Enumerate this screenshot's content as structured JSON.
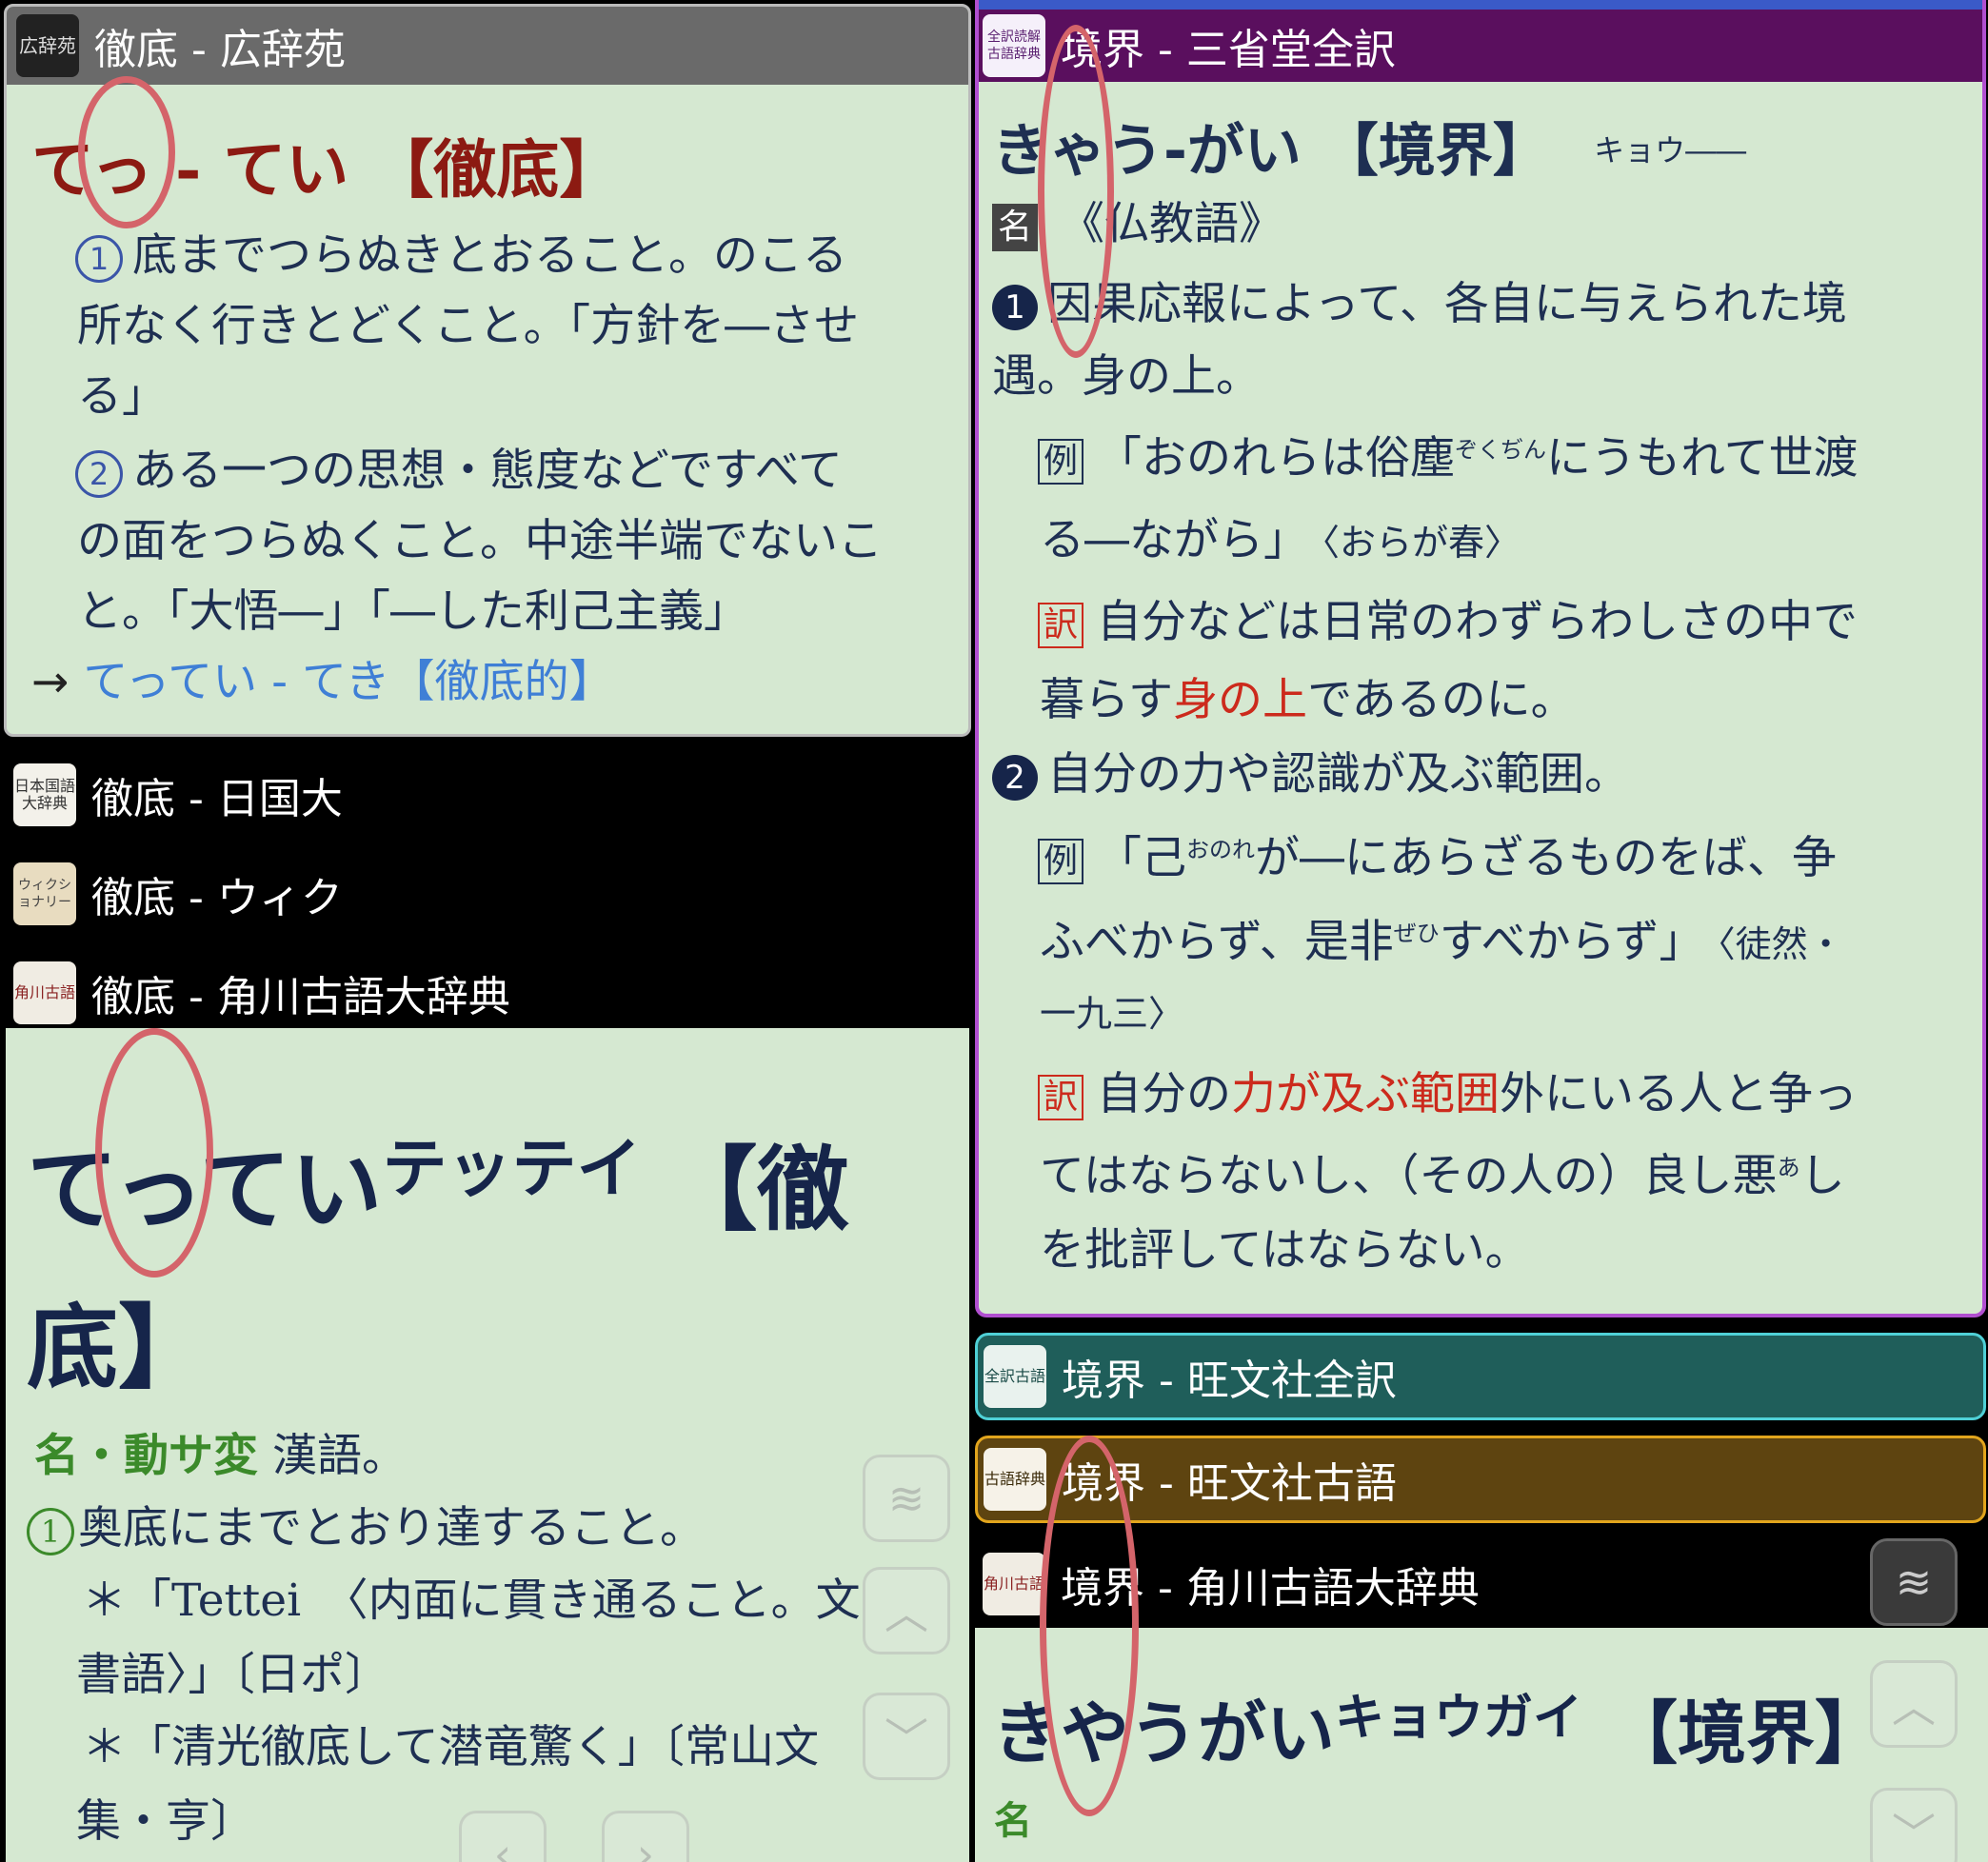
{
  "left_top": {
    "title_bar": {
      "icon": "広辞苑",
      "title": "徹底 - 広辞苑"
    },
    "headword": "てっ - てい 【徹底】",
    "lines": [
      "底までつらぬきとおること。のこる",
      "所なく行きとどくこと。「方針を―させ",
      "る」",
      "ある一つの思想・態度などですべて",
      "の面をつらぬくこと。中途半端でないこ",
      "と。「大悟―」「―した利己主義」"
    ],
    "num1": "1",
    "num2": "2",
    "link_arrow": "→",
    "link": "てってい - てき【徹底的】"
  },
  "left_list": [
    {
      "icon": "日本国語大辞典",
      "title": "徹底 - 日国大"
    },
    {
      "icon": "ウィクショナリー",
      "title": "徹底 - ウィク"
    },
    {
      "icon": "角川古語",
      "title": "徹底 - 角川古語大辞典"
    }
  ],
  "left_bottom": {
    "headword_kana": "てってい",
    "headword_katakana": "テッテイ",
    "headword_kanji_1": "【徹",
    "headword_kanji_2": "底】",
    "pos": "名・動サ変",
    "pos_rest": " 漢語。",
    "num1": "1",
    "lines": [
      "奥底にまでとおり達すること。",
      "＊「Tettei　〈内面に貫き通ること。文",
      "書語〉」〔日ポ〕",
      "＊「清光徹底して潜竜驚く」〔常山文",
      "集・亨〕"
    ]
  },
  "right_top": {
    "title_bar": {
      "icon": "全訳読解古語辞典",
      "title": "境界 - 三省堂全訳"
    },
    "headword": "きゃう-がい 【境界】",
    "reading": "キョウ――",
    "pos_tag": "名",
    "pos_text": "《仏教語》",
    "sense1_num": "1",
    "sense1": [
      "因果応報によって、各自に与えられた境",
      "遇。身の上。"
    ],
    "example_tag": "例",
    "example1": [
      "「おのれらは俗塵",
      "ぞくぢん",
      "にうもれて世渡",
      "る―ながら」",
      "〈おらが春〉"
    ],
    "translation_tag": "訳",
    "trans1_a": "自分などは日常のわずらわしさの中で",
    "trans1_b_pre": "暮らす",
    "trans1_b_red": "身の上",
    "trans1_b_post": "であるのに。",
    "sense2_num": "2",
    "sense2": "自分の力や認識が及ぶ範囲。",
    "example2": [
      "「己",
      "おのれ",
      "が―にあらざるものをば、争",
      "ふべからず、是非",
      "ぜひ",
      "すべからず」",
      "〈徒然・",
      "一九三〉"
    ],
    "trans2_a_pre": "自分の",
    "trans2_a_red": "力が及ぶ範囲",
    "trans2_a_post": "外にいる人と争っ",
    "trans2_b": "てはならないし、（その人の）良し悪",
    "trans2_b_ruby": "あ",
    "trans2_b_post": "し",
    "trans2_c": "を批評してはならない。"
  },
  "right_list": [
    {
      "icon": "全訳古語",
      "title": "境界 - 旺文社全訳",
      "color": "#1f5e5a",
      "border": "#4fd0d6"
    },
    {
      "icon": "古語辞典",
      "title": "境界 - 旺文社古語",
      "color": "#5e4410",
      "border": "#e2a51d"
    },
    {
      "icon": "角川古語",
      "title": "境界 - 角川古語大辞典",
      "color": "#000000",
      "border": "#000000"
    }
  ],
  "right_bottom": {
    "headword_kana": "きやうがい",
    "headword_katakana": "キョウガイ",
    "headword_kanji": "【境界】",
    "pos": "名"
  },
  "controls": {
    "layers": "≋",
    "up": "︿",
    "down": "﹀",
    "back": "‹",
    "forward": "›"
  }
}
